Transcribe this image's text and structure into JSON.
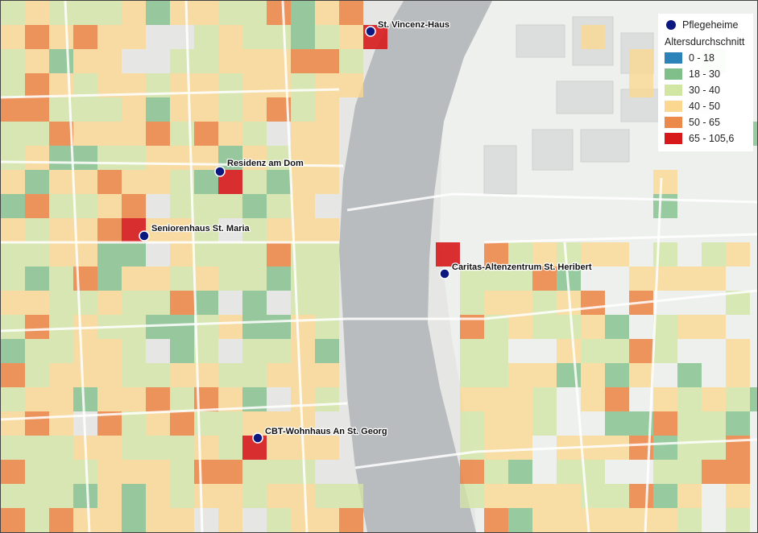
{
  "legend": {
    "point_label": "Pflegeheime",
    "title": "Altersdurchschnitt",
    "classes": [
      {
        "label": "0 - 18",
        "color": "#2b83ba"
      },
      {
        "label": "18 - 30",
        "color": "#80bf89"
      },
      {
        "label": "30 - 40",
        "color": "#d2e6a4"
      },
      {
        "label": "40 - 50",
        "color": "#fbd78f"
      },
      {
        "label": "50 - 65",
        "color": "#ec8a4c"
      },
      {
        "label": "65 - 105,6",
        "color": "#d7191c"
      }
    ]
  },
  "care_homes": [
    {
      "name": "St. Vincenz-Haus"
    },
    {
      "name": "Residenz am Dom"
    },
    {
      "name": "Seniorenhaus St. Maria"
    },
    {
      "name": "Caritas-Altenzentrum St. Heribert"
    },
    {
      "name": "CBT-Wohnhaus An St. Georg"
    }
  ],
  "colors": {
    "river": "#b9bcbf",
    "land_west": "#e6e7e5",
    "land_east": "#eef0ee",
    "marker": "#0c1880"
  }
}
